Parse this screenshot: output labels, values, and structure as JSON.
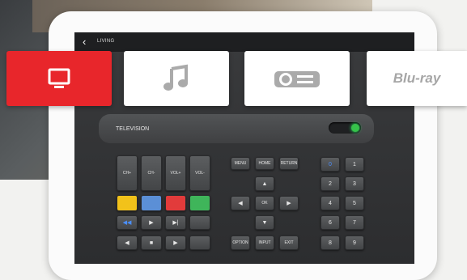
{
  "header": {
    "back_icon": "chevron-left-icon",
    "title": "LIVING"
  },
  "sources": [
    {
      "name": "television",
      "icon": "tv-icon",
      "active": true
    },
    {
      "name": "music",
      "icon": "music-note-icon",
      "active": false
    },
    {
      "name": "projector",
      "icon": "projector-icon",
      "active": false
    },
    {
      "name": "bluray",
      "logo": "Blu-ray",
      "active": false
    }
  ],
  "panel": {
    "label": "TELEVISION",
    "toggle_on": true
  },
  "tv_buttons": {
    "ch_up": "CH+",
    "ch_down": "CH-",
    "vol_up": "VOL+",
    "vol_down": "VOL-"
  },
  "color_buttons": {
    "yellow": "#f2c21a",
    "blue": "#5b8fd6",
    "red": "#e23b3b",
    "green": "#3fb55a"
  },
  "nav_buttons": {
    "menu": "MENU",
    "home": "HOME",
    "return": "RETURN",
    "ok": "OK",
    "option": "OPTION",
    "input": "INPUT",
    "exit": "EXIT"
  },
  "keypad": {
    "zero": "0",
    "one": "1",
    "two": "2",
    "three": "3",
    "four": "4",
    "five": "5",
    "six": "6",
    "seven": "7",
    "eight": "8",
    "nine": "9"
  },
  "colors": {
    "accent_red": "#e8262b",
    "screen": "#2f3032",
    "zero_key": "#4a8fff"
  }
}
